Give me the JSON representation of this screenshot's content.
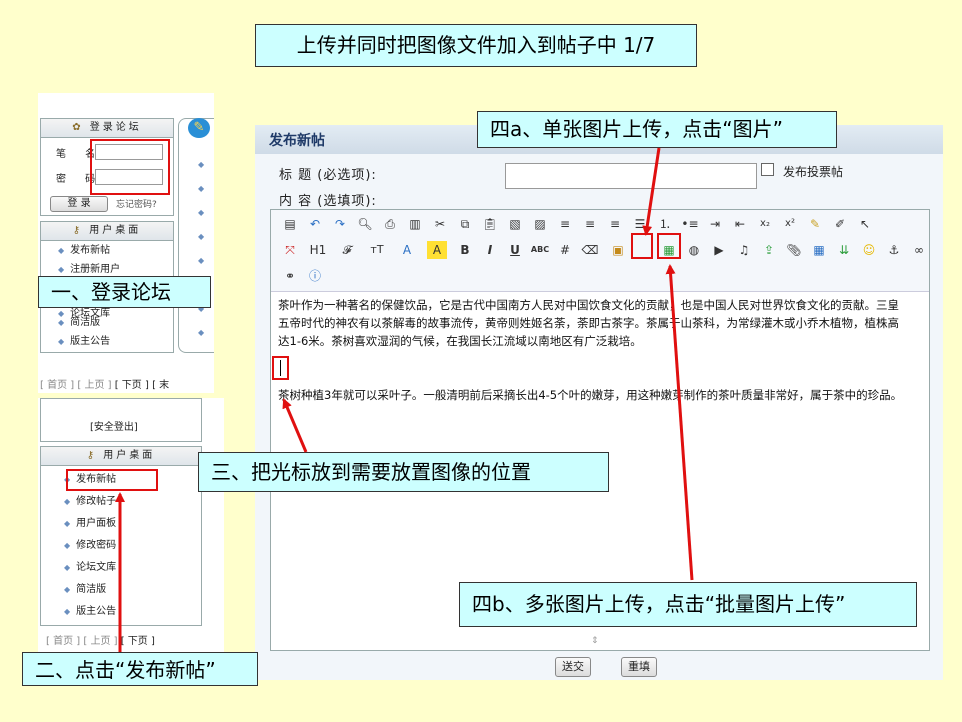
{
  "slide": {
    "title": "上传并同时把图像文件加入到帖子中 1/7",
    "callout_login": "一、登录论坛",
    "callout_click_post": "二、点击“发布新帖”",
    "callout_cursor": "三、把光标放到需要放置图像的位置",
    "callout_single": "四a、单张图片上传，点击“图片”",
    "callout_batch": "四b、多张图片上传，点击“批量图片上传”"
  },
  "login_panel": {
    "header": "登录论坛",
    "username_label": "笔 名",
    "password_label": "密 码",
    "username_value": "",
    "password_value": "",
    "login_button": "登 录",
    "forgot_link": "忘记密码?",
    "desk_header": "用户桌面",
    "menu": [
      "发布新帖",
      "注册新用户",
      "论坛文库",
      "简洁版",
      "版主公告"
    ],
    "pager": [
      "[ 首页 ]",
      "[ 上页 ]",
      "[ 下页 ]",
      "[ 末"
    ]
  },
  "user_panel": {
    "logout": "[安全登出]",
    "desk_header": "用户桌面",
    "menu": [
      "发布新帖",
      "修改帖子",
      "用户面板",
      "修改密码",
      "论坛文库",
      "简洁版",
      "版主公告"
    ],
    "pager": [
      "[ 首页 ]",
      "[ 上页 ]",
      "[ 下页 ]"
    ]
  },
  "post_form": {
    "header": "发布新帖",
    "subject_label": "标 题 (必选项):",
    "content_label": "内 容 (选填项):",
    "subject_value": "",
    "poll_checkbox_label": "发布投票帖",
    "poll_checked": false,
    "toolbar_text": {
      "heading": "H1",
      "font": "𝓕",
      "size": "тT",
      "font_color": "A",
      "highlight": "A",
      "bold": "B",
      "italic": "I",
      "underline": "U",
      "spellcheck": "ABC",
      "subscript": "x₂",
      "superscript": "x²"
    },
    "paragraph1": "茶叶作为一种著名的保健饮品，它是古代中国南方人民对中国饮食文化的贡献，也是中国人民对世界饮食文化的贡献。三皇五帝时代的神农有以茶解毒的故事流传，黄帝则姓姬名荼，荼即古茶字。茶属于山茶科，为常绿灌木或小乔木植物，植株高达1-6米。茶树喜欢湿润的气候，在我国长江流域以南地区有广泛栽培。",
    "paragraph2": "茶树种植3年就可以采叶子。一般清明前后采摘长出4-5个叶的嫩芽，用这种嫩芽制作的茶叶质量非常好，属于茶中的珍品。",
    "submit_button": "送交",
    "reset_button": "重填"
  },
  "colors": {
    "background": "#FFFFCC",
    "callout": "#CCFFFF",
    "highlight": "#E01010",
    "form_header": "#1F3A68"
  }
}
